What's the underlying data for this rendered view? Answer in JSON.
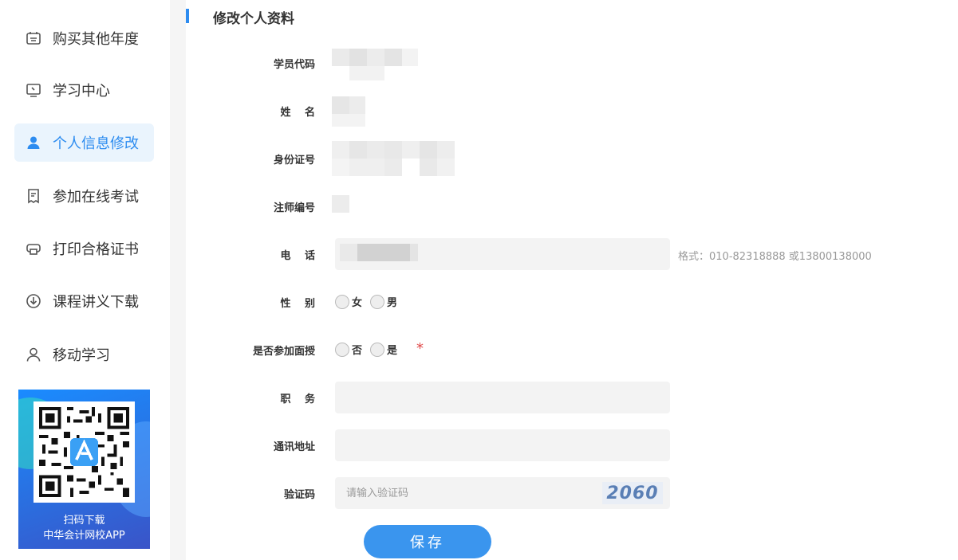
{
  "sidebar": {
    "items": [
      {
        "label": "购买其他年度",
        "icon": "cart-icon"
      },
      {
        "label": "学习中心",
        "icon": "monitor-icon"
      },
      {
        "label": "个人信息修改",
        "icon": "user-icon"
      },
      {
        "label": "参加在线考试",
        "icon": "document-icon"
      },
      {
        "label": "打印合格证书",
        "icon": "printer-icon"
      },
      {
        "label": "课程讲义下载",
        "icon": "download-icon"
      },
      {
        "label": "移动学习",
        "icon": "person-icon"
      }
    ],
    "active_index": 2,
    "qr": {
      "line1": "扫码下载",
      "line2": "中华会计网校APP"
    }
  },
  "form": {
    "title": "修改个人资料",
    "labels": {
      "student_code": "学员代码",
      "name": "姓　 名",
      "id_number": "身份证号",
      "cpa_number": "注师编号",
      "phone": "电　 话",
      "gender": "性　 别",
      "attend_face": "是否参加面授",
      "position": "职　 务",
      "address": "通讯地址",
      "captcha": "验证码"
    },
    "phone_hint": "格式：010-82318888 或13800138000",
    "gender_options": [
      "女",
      "男"
    ],
    "attend_options": [
      "否",
      "是"
    ],
    "required_mark": "*",
    "captcha_placeholder": "请输入验证码",
    "captcha_code": "2060",
    "save_label": "保存"
  },
  "colors": {
    "accent": "#2d8cf0",
    "active_bg": "#eaf4fd",
    "button": "#3a95ee",
    "required": "#e04848"
  }
}
